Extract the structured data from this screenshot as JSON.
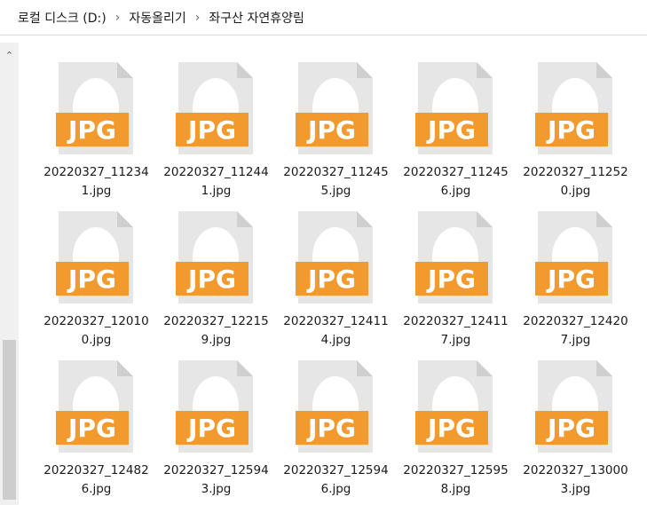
{
  "breadcrumb": {
    "items": [
      "로컬 디스크 (D:)",
      "자동올리기",
      "좌구산 자연휴양림"
    ]
  },
  "icon_colors": {
    "badge": "#f29a2e",
    "page": "#e6e6e6"
  },
  "files": [
    {
      "line1": "20220327_11234",
      "line2": "1.jpg",
      "badge": "JPG"
    },
    {
      "line1": "20220327_11244",
      "line2": "1.jpg",
      "badge": "JPG"
    },
    {
      "line1": "20220327_11245",
      "line2": "5.jpg",
      "badge": "JPG"
    },
    {
      "line1": "20220327_11245",
      "line2": "6.jpg",
      "badge": "JPG"
    },
    {
      "line1": "20220327_11252",
      "line2": "0.jpg",
      "badge": "JPG"
    },
    {
      "line1": "20220327_12010",
      "line2": "0.jpg",
      "badge": "JPG"
    },
    {
      "line1": "20220327_12215",
      "line2": "9.jpg",
      "badge": "JPG"
    },
    {
      "line1": "20220327_12411",
      "line2": "4.jpg",
      "badge": "JPG"
    },
    {
      "line1": "20220327_12411",
      "line2": "7.jpg",
      "badge": "JPG"
    },
    {
      "line1": "20220327_12420",
      "line2": "7.jpg",
      "badge": "JPG"
    },
    {
      "line1": "20220327_12482",
      "line2": "6.jpg",
      "badge": "JPG"
    },
    {
      "line1": "20220327_12594",
      "line2": "3.jpg",
      "badge": "JPG"
    },
    {
      "line1": "20220327_12594",
      "line2": "6.jpg",
      "badge": "JPG"
    },
    {
      "line1": "20220327_12595",
      "line2": "8.jpg",
      "badge": "JPG"
    },
    {
      "line1": "20220327_13000",
      "line2": "3.jpg",
      "badge": "JPG"
    }
  ]
}
